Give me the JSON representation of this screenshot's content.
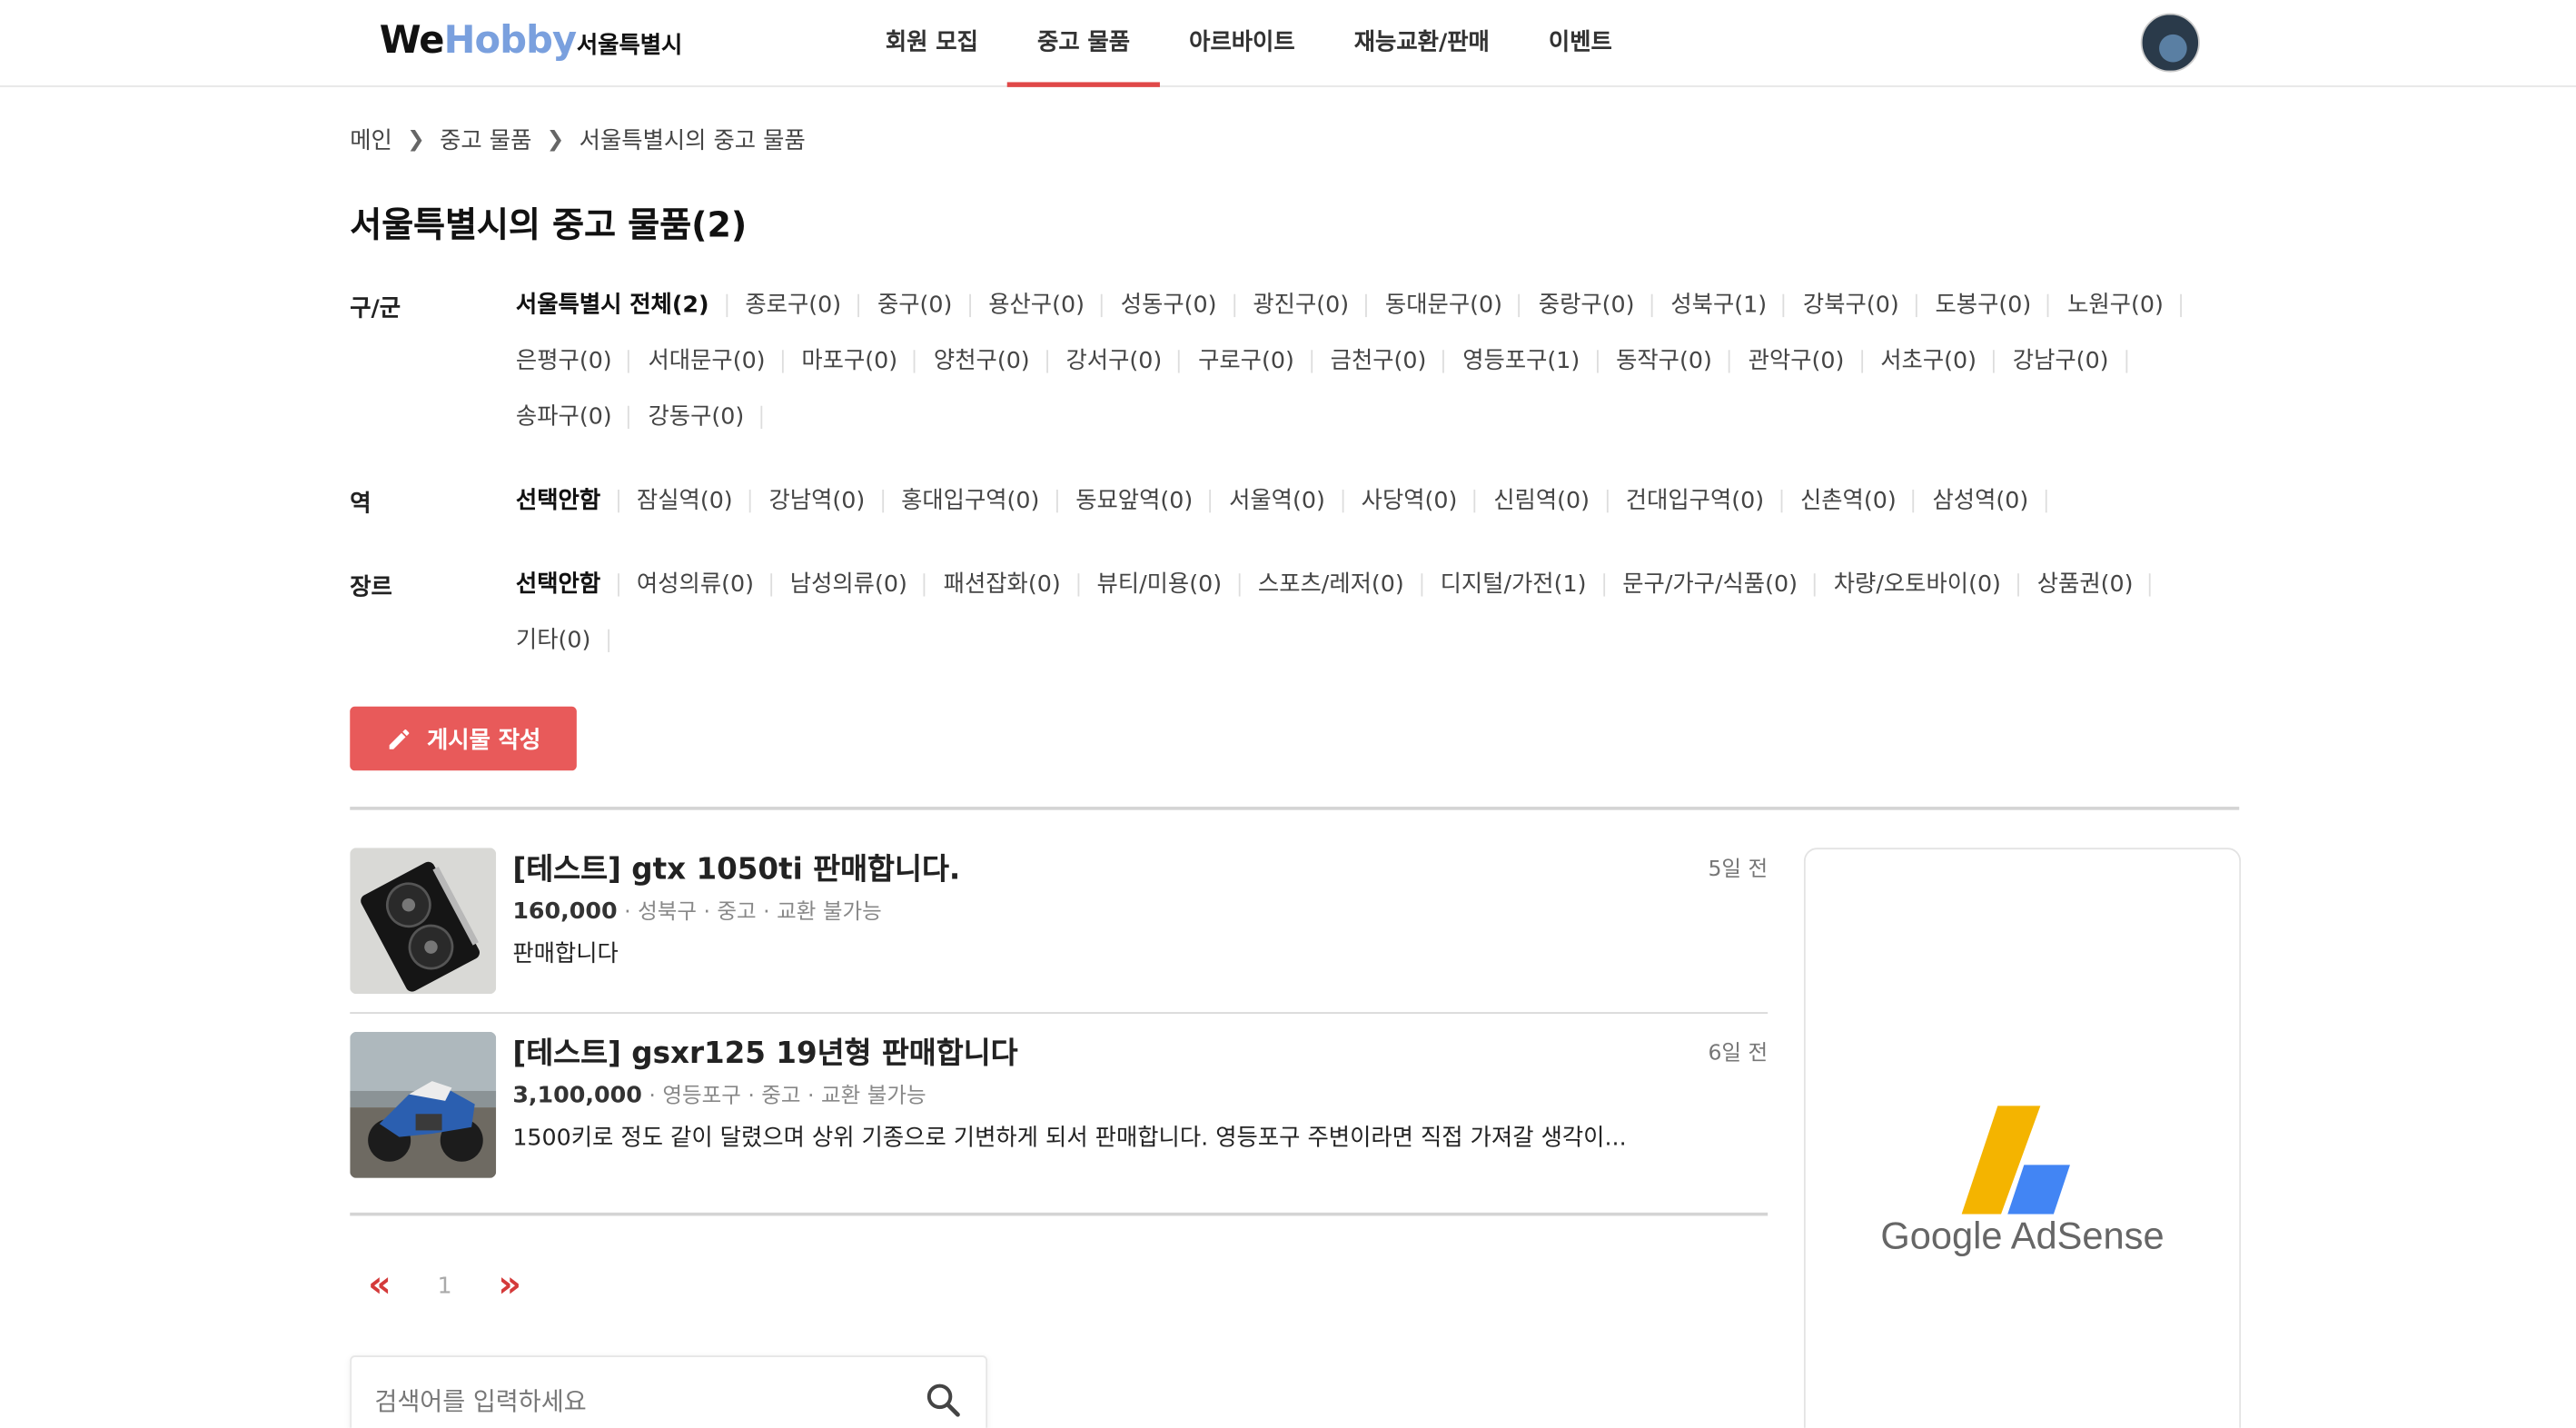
{
  "header": {
    "logo_we": "We",
    "logo_hobby": "Hobby",
    "region": "서울특별시",
    "nav": [
      {
        "label": "회원 모집",
        "active": false
      },
      {
        "label": "중고 물품",
        "active": true
      },
      {
        "label": "아르바이트",
        "active": false
      },
      {
        "label": "재능교환/판매",
        "active": false
      },
      {
        "label": "이벤트",
        "active": false
      }
    ]
  },
  "breadcrumb": [
    "메인",
    "중고 물품",
    "서울특별시의 중고 물품"
  ],
  "title": "서울특별시의 중고 물품(2)",
  "filters": {
    "district": {
      "label": "구/군",
      "options": [
        "서울특별시 전체(2)",
        "종로구(0)",
        "중구(0)",
        "용산구(0)",
        "성동구(0)",
        "광진구(0)",
        "동대문구(0)",
        "중랑구(0)",
        "성북구(1)",
        "강북구(0)",
        "도봉구(0)",
        "노원구(0)",
        "은평구(0)",
        "서대문구(0)",
        "마포구(0)",
        "양천구(0)",
        "강서구(0)",
        "구로구(0)",
        "금천구(0)",
        "영등포구(1)",
        "동작구(0)",
        "관악구(0)",
        "서초구(0)",
        "강남구(0)",
        "송파구(0)",
        "강동구(0)"
      ]
    },
    "station": {
      "label": "역",
      "options": [
        "선택안함",
        "잠실역(0)",
        "강남역(0)",
        "홍대입구역(0)",
        "동묘앞역(0)",
        "서울역(0)",
        "사당역(0)",
        "신림역(0)",
        "건대입구역(0)",
        "신촌역(0)",
        "삼성역(0)"
      ]
    },
    "genre": {
      "label": "장르",
      "options": [
        "선택안함",
        "여성의류(0)",
        "남성의류(0)",
        "패션잡화(0)",
        "뷰티/미용(0)",
        "스포츠/레저(0)",
        "디지털/가전(1)",
        "문구/가구/식품(0)",
        "차량/오토바이(0)",
        "상품권(0)",
        "기타(0)"
      ]
    }
  },
  "write_button": "게시물 작성",
  "listings": [
    {
      "title": "[테스트] gtx 1050ti 판매합니다.",
      "price": "160,000",
      "meta": " · 성북구 · 중고 · 교환 불가능",
      "desc": "판매합니다",
      "time": "5일 전",
      "image": "graphics-card"
    },
    {
      "title": "[테스트] gsxr125 19년형 판매합니다",
      "price": "3,100,000",
      "meta": " · 영등포구 · 중고 · 교환 불가능",
      "desc": "1500키로 정도 같이 달렸으며 상위 기종으로 기변하게 되서 판매합니다. 영등포구 주변이라면 직접 가져갈 생각이...",
      "time": "6일 전",
      "image": "motorcycle"
    }
  ],
  "pagination": {
    "prev": "«",
    "current": "1",
    "next": "»"
  },
  "search": {
    "placeholder": "검색어를 입력하세요"
  },
  "ad": {
    "text": "Google AdSense",
    "colors": {
      "yellow": "#f4b400",
      "blue": "#4285f4"
    }
  },
  "colors": {
    "accent": "#e85a5a",
    "logo_blue": "#7aa0de"
  }
}
